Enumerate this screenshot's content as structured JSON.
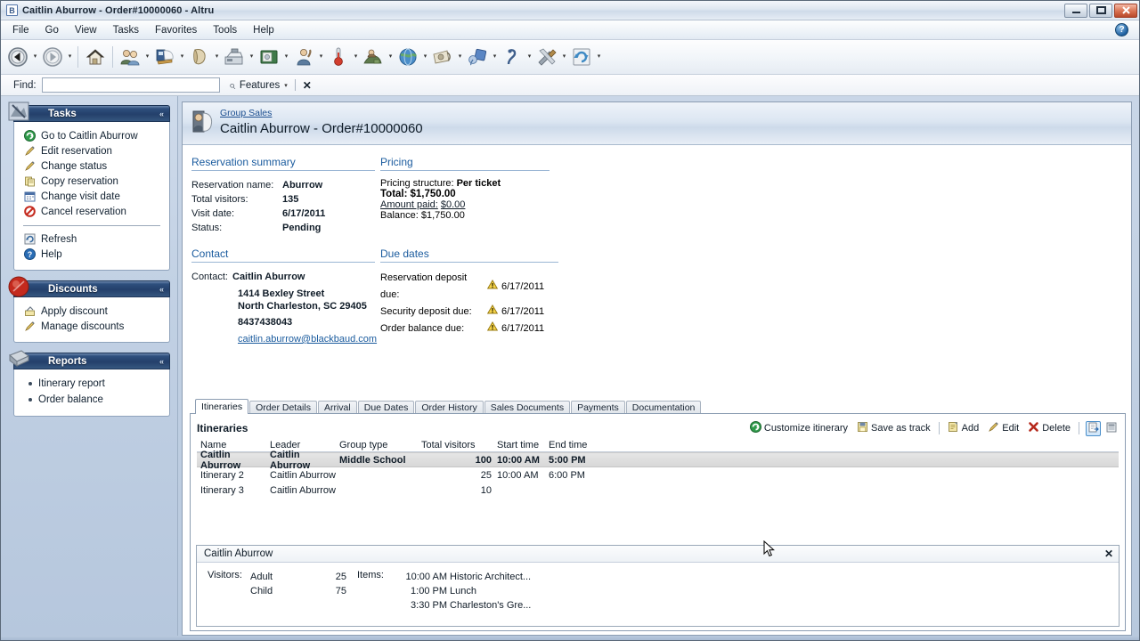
{
  "window": {
    "title": "Caitlin Aburrow - Order#10000060 - Altru",
    "app_icon": "B",
    "minimize": "—",
    "maximize": "❐",
    "close": "✕"
  },
  "menu": {
    "items": [
      "File",
      "Go",
      "View",
      "Tasks",
      "Favorites",
      "Tools",
      "Help"
    ],
    "help_icon": "?"
  },
  "toolbar": {
    "buttons": [
      {
        "icon": "back-icon",
        "has_arrow": true
      },
      {
        "icon": "forward-icon",
        "has_arrow": true
      },
      {
        "icon": "home-icon",
        "has_arrow": false
      },
      {
        "icon": "constituents-icon",
        "has_arrow": true
      },
      {
        "icon": "revenue-icon",
        "has_arrow": true
      },
      {
        "icon": "memberships-icon",
        "has_arrow": true
      },
      {
        "icon": "sales-icon",
        "has_arrow": true
      },
      {
        "icon": "tickets-icon",
        "has_arrow": true
      },
      {
        "icon": "volunteers-icon",
        "has_arrow": true
      },
      {
        "icon": "analysis-icon",
        "has_arrow": true
      },
      {
        "icon": "fundraising-icon",
        "has_arrow": true
      },
      {
        "icon": "web-icon",
        "has_arrow": true
      },
      {
        "icon": "marketing-icon",
        "has_arrow": true
      },
      {
        "icon": "events-icon",
        "has_arrow": true
      },
      {
        "icon": "prospects-icon",
        "has_arrow": true
      },
      {
        "icon": "administration-icon",
        "has_arrow": true
      },
      {
        "icon": "refresh-icon",
        "has_arrow": true
      }
    ]
  },
  "find": {
    "label": "Find:",
    "value": "",
    "placeholder": "",
    "features_label": "Features",
    "dropdown_caret": "▾",
    "close": "✕",
    "search_icon": "search-icon"
  },
  "sidebar": {
    "panels": [
      {
        "title": "Tasks",
        "collapse_glyph": "«",
        "badge_icon": "tasks-badge-icon",
        "items": [
          {
            "label": "Go to Caitlin Aburrow",
            "icon": "goto-icon"
          },
          {
            "label": "Edit reservation",
            "icon": "pencil-icon"
          },
          {
            "label": "Change status",
            "icon": "pencil-icon"
          },
          {
            "label": "Copy reservation",
            "icon": "copy-icon"
          },
          {
            "label": "Change visit date",
            "icon": "calendar-icon"
          },
          {
            "label": "Cancel reservation",
            "icon": "cancel-icon"
          }
        ],
        "items_after": [
          {
            "label": "Refresh",
            "icon": "refresh-icon"
          },
          {
            "label": "Help",
            "icon": "help-icon"
          }
        ]
      },
      {
        "title": "Discounts",
        "collapse_glyph": "«",
        "badge_icon": "discount-badge-icon",
        "items": [
          {
            "label": "Apply discount",
            "icon": "apply-discount-icon"
          },
          {
            "label": "Manage discounts",
            "icon": "pencil-icon"
          }
        ],
        "items_after": []
      },
      {
        "title": "Reports",
        "collapse_glyph": "«",
        "badge_icon": "reports-badge-icon",
        "bullets": [
          "Itinerary report",
          "Order balance"
        ]
      }
    ]
  },
  "header": {
    "breadcrumb": "Group Sales",
    "title": "Caitlin Aburrow - Order#10000060",
    "icon": "group-sales-icon"
  },
  "reservation_summary": {
    "section_title": "Reservation summary",
    "rows": [
      {
        "label": "Reservation name:",
        "value": "Aburrow"
      },
      {
        "label": "Total visitors:",
        "value": "135"
      },
      {
        "label": "Visit date:",
        "value": "6/17/2011"
      },
      {
        "label": "Status:",
        "value": "Pending"
      }
    ]
  },
  "pricing": {
    "section_title": "Pricing",
    "rows": [
      {
        "label": "Pricing structure:",
        "value": "Per ticket",
        "bold": false,
        "underline": false
      },
      {
        "label": "Total:",
        "value": "$1,750.00",
        "bold": true,
        "underline": false
      },
      {
        "label": "Amount paid:",
        "value": "$0.00",
        "bold": false,
        "underline": true
      },
      {
        "label": "Balance:",
        "value": "$1,750.00",
        "bold": false,
        "underline": false
      }
    ]
  },
  "contact": {
    "section_title": "Contact",
    "label": "Contact:",
    "name": "Caitlin Aburrow",
    "address_line1": "1414 Bexley Street",
    "address_line2": "North Charleston, SC  29405",
    "phone": "8437438043",
    "email": "caitlin.aburrow@blackbaud.com"
  },
  "due_dates": {
    "section_title": "Due dates",
    "warning_icon": "warning-icon",
    "rows": [
      {
        "label": "Reservation deposit due:",
        "date": "6/17/2011"
      },
      {
        "label": "Security deposit due:",
        "date": "6/17/2011"
      },
      {
        "label": "Order balance due:",
        "date": "6/17/2011"
      }
    ]
  },
  "tabs": {
    "active_index": 0,
    "items": [
      "Itineraries",
      "Order Details",
      "Arrival",
      "Due Dates",
      "Order History",
      "Sales Documents",
      "Payments",
      "Documentation"
    ]
  },
  "itineraries": {
    "pane_title": "Itineraries",
    "tools": [
      {
        "label": "Customize itinerary",
        "icon": "customize-icon"
      },
      {
        "label": "Save as track",
        "icon": "save-icon"
      },
      {
        "label": "Add",
        "icon": "add-icon"
      },
      {
        "label": "Edit",
        "icon": "pencil-icon"
      },
      {
        "label": "Delete",
        "icon": "delete-icon"
      }
    ],
    "icon_buttons": [
      {
        "icon": "export-icon",
        "selected": true
      },
      {
        "icon": "columns-icon",
        "selected": false
      }
    ],
    "columns": [
      "Name",
      "Leader",
      "Group type",
      "Total visitors",
      "Start time",
      "End time"
    ],
    "rows": [
      {
        "name": "Caitlin Aburrow",
        "leader": "Caitlin Aburrow",
        "group_type": "Middle School",
        "total_visitors": "100",
        "start_time": "10:00 AM",
        "end_time": "5:00 PM",
        "selected": true
      },
      {
        "name": "Itinerary 2",
        "leader": "Caitlin Aburrow",
        "group_type": "",
        "total_visitors": "25",
        "start_time": "10:00 AM",
        "end_time": "6:00 PM",
        "selected": false
      },
      {
        "name": "Itinerary 3",
        "leader": "Caitlin Aburrow",
        "group_type": "",
        "total_visitors": "10",
        "start_time": "",
        "end_time": "",
        "selected": false
      }
    ]
  },
  "detail_drawer": {
    "title": "Caitlin Aburrow",
    "close": "✕",
    "visitors_label": "Visitors:",
    "visitors": [
      {
        "type": "Adult",
        "count": "25"
      },
      {
        "type": "Child",
        "count": "75"
      }
    ],
    "items_label": "Items:",
    "items": [
      {
        "time": "10:00 AM",
        "name": "Historic Architect..."
      },
      {
        "time": "1:00 PM",
        "name": "Lunch"
      },
      {
        "time": "3:30 PM",
        "name": "Charleston's Gre..."
      }
    ]
  },
  "colors": {
    "panel_header_blue": "#24406b",
    "link_blue": "#1a5b9e",
    "section_rule": "#9bb6d4",
    "selected_row": "#dddddd",
    "warning_amber": "#f0b400"
  }
}
